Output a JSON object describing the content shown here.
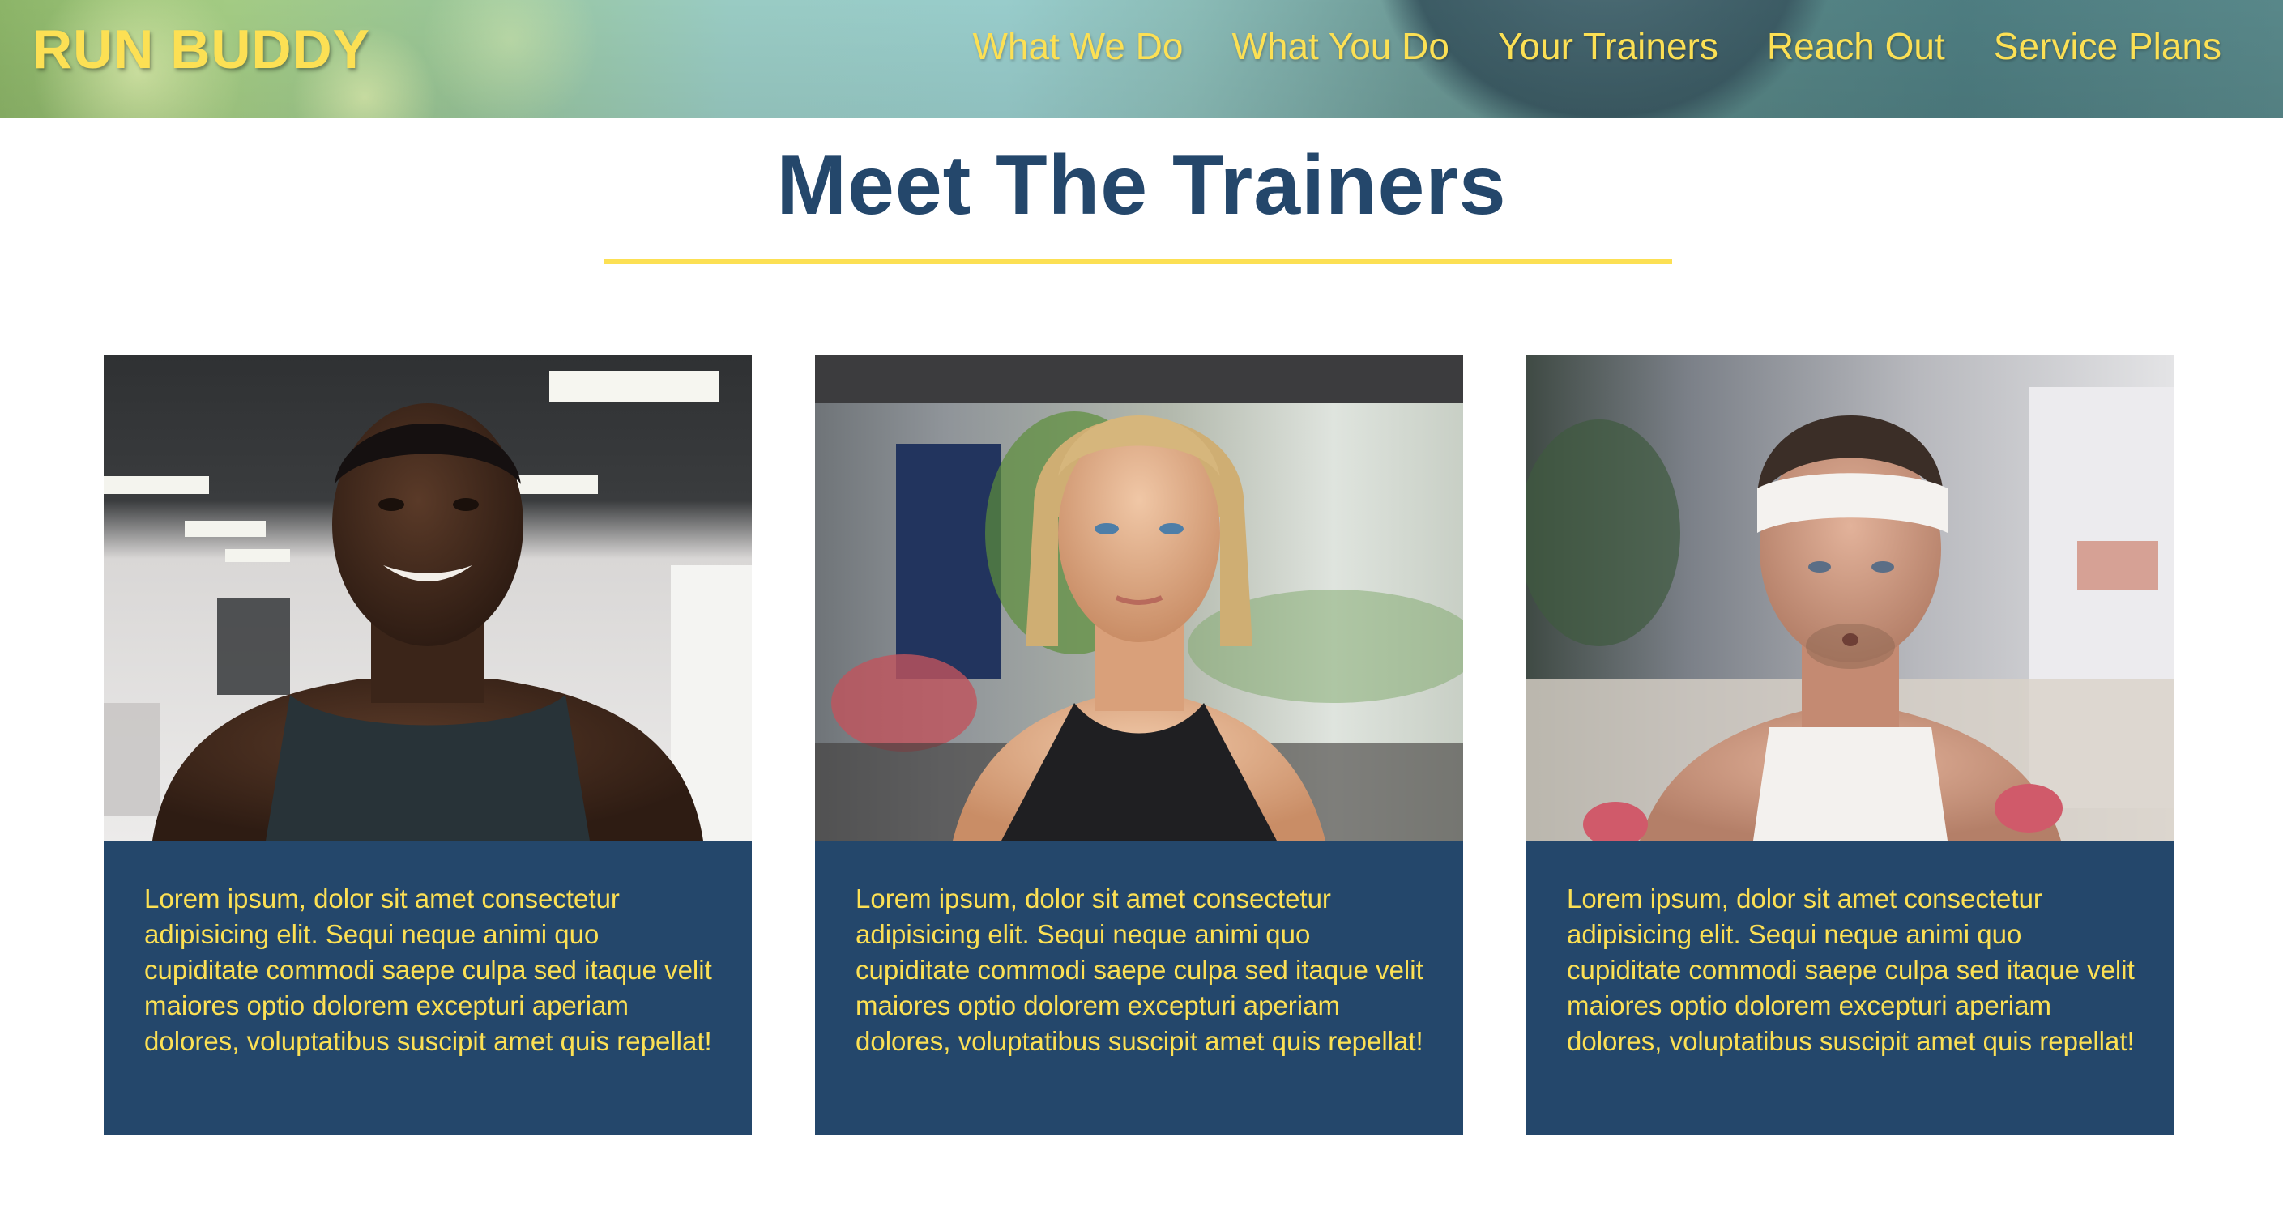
{
  "header": {
    "logo": "RUN BUDDY",
    "nav": [
      "What We Do",
      "What You Do",
      "Your Trainers",
      "Reach Out",
      "Service Plans"
    ]
  },
  "section": {
    "title": "Meet The Trainers"
  },
  "trainers": [
    {
      "photo": "trainer-photo-man-smiling-gym",
      "bio": "Lorem ipsum, dolor sit amet consectetur adipisicing elit. Sequi neque animi quo cupiditate commodi saepe culpa sed itaque velit maiores optio dolorem excepturi aperiam dolores, voluptatibus suscipit amet quis repellat!"
    },
    {
      "photo": "trainer-photo-woman-ponytail-gym",
      "bio": "Lorem ipsum, dolor sit amet consectetur adipisicing elit. Sequi neque animi quo cupiditate commodi saepe culpa sed itaque velit maiores optio dolorem excepturi aperiam dolores, voluptatibus suscipit amet quis repellat!"
    },
    {
      "photo": "trainer-photo-man-headband-dumbbells",
      "bio": "Lorem ipsum, dolor sit amet consectetur adipisicing elit. Sequi neque animi quo cupiditate commodi saepe culpa sed itaque velit maiores optio dolorem excepturi aperiam dolores, voluptatibus suscipit amet quis repellat!"
    }
  ],
  "colors": {
    "brand_yellow": "#fce054",
    "brand_navy": "#24476b",
    "background": "#ffffff"
  }
}
